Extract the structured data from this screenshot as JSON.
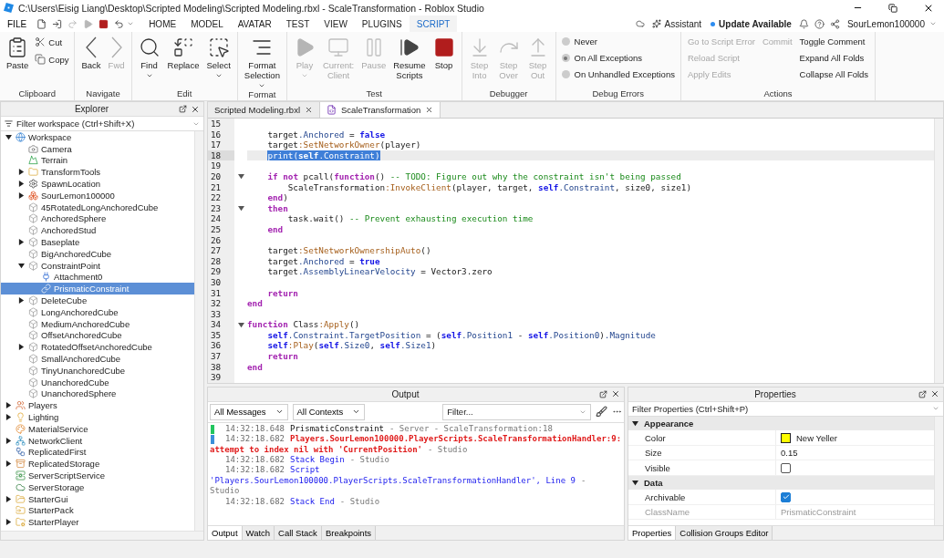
{
  "window": {
    "title": "C:\\Users\\Eisig Liang\\Desktop\\Scripted Modeling\\Scripted Modeling.rbxl - ScaleTransformation - Roblox Studio"
  },
  "menubar": {
    "file_menu": "FILE",
    "quick_actions": [
      {
        "disabled": false
      },
      {
        "disabled": false
      },
      {
        "disabled": true
      },
      {
        "disabled": true
      },
      {
        "disabled": false
      },
      {
        "disabled": false
      }
    ],
    "tabs": [
      {
        "label": "HOME",
        "selected": false
      },
      {
        "label": "MODEL",
        "selected": false
      },
      {
        "label": "AVATAR",
        "selected": false
      },
      {
        "label": "TEST",
        "selected": false
      },
      {
        "label": "VIEW",
        "selected": false
      },
      {
        "label": "PLUGINS",
        "selected": false
      },
      {
        "label": "SCRIPT",
        "selected": true
      }
    ],
    "assistant": "Assistant",
    "update": "Update Available",
    "user": "SourLemon100000"
  },
  "ribbon": {
    "groups": [
      {
        "label": "Clipboard",
        "columns": [
          [
            {
              "kind": "large",
              "label": "Paste",
              "disabled": false,
              "dropdown": false
            }
          ],
          [
            {
              "kind": "small",
              "label": "Cut",
              "disabled": false
            },
            {
              "kind": "small",
              "label": "Copy",
              "disabled": false
            }
          ]
        ]
      },
      {
        "label": "Navigate",
        "columns": [
          [
            {
              "kind": "large",
              "label": "Back",
              "disabled": false,
              "dropdown": false
            }
          ],
          [
            {
              "kind": "large",
              "label": "Fwd",
              "disabled": true,
              "dropdown": false
            }
          ]
        ]
      },
      {
        "label": "Edit",
        "columns": [
          [
            {
              "kind": "large",
              "label": "Find",
              "disabled": false,
              "dropdown": true
            }
          ],
          [
            {
              "kind": "large",
              "label": "Replace",
              "disabled": false,
              "dropdown": false
            }
          ],
          [
            {
              "kind": "large",
              "label": "Select",
              "disabled": false,
              "dropdown": true
            }
          ]
        ]
      },
      {
        "label": "Format",
        "columns": [
          [
            {
              "kind": "large",
              "label": "Format\nSelection",
              "disabled": false,
              "dropdown": true
            }
          ]
        ]
      },
      {
        "label": "Test",
        "columns": [
          [
            {
              "kind": "large",
              "label": "Play",
              "disabled": true,
              "dropdown": true
            }
          ],
          [
            {
              "kind": "large",
              "label": "Current:\nClient",
              "disabled": true,
              "dropdown": false
            }
          ],
          [
            {
              "kind": "large",
              "label": "Pause",
              "disabled": true,
              "dropdown": false
            }
          ],
          [
            {
              "kind": "large",
              "label": "Resume\nScripts",
              "disabled": false,
              "dropdown": false
            }
          ],
          [
            {
              "kind": "large",
              "label": "Stop",
              "disabled": false,
              "dropdown": false
            }
          ]
        ]
      },
      {
        "label": "Debugger",
        "columns": [
          [
            {
              "kind": "large",
              "label": "Step\nInto",
              "disabled": true,
              "dropdown": false
            }
          ],
          [
            {
              "kind": "large",
              "label": "Step\nOver",
              "disabled": true,
              "dropdown": false
            }
          ],
          [
            {
              "kind": "large",
              "label": "Step\nOut",
              "disabled": true,
              "dropdown": false
            }
          ]
        ]
      },
      {
        "label": "Debug Errors",
        "columns": [
          [
            {
              "kind": "radio",
              "label": "Never",
              "selected": false
            },
            {
              "kind": "radio",
              "label": "On All Exceptions",
              "selected": true
            },
            {
              "kind": "radio",
              "label": "On Unhandled Exceptions",
              "selected": false
            }
          ]
        ]
      },
      {
        "label": "Actions",
        "columns": [
          [
            {
              "kind": "link",
              "label": "Go to Script Error",
              "disabled": true
            },
            {
              "kind": "link",
              "label": "Reload Script",
              "disabled": true
            },
            {
              "kind": "link",
              "label": "Apply Edits",
              "disabled": true
            }
          ],
          [
            {
              "kind": "link",
              "label": "Commit",
              "disabled": true
            }
          ],
          [
            {
              "kind": "link",
              "label": "Toggle Comment",
              "disabled": false
            },
            {
              "kind": "link",
              "label": "Expand All Folds",
              "disabled": false
            },
            {
              "kind": "link",
              "label": "Collapse All Folds",
              "disabled": false
            }
          ]
        ]
      }
    ]
  },
  "explorer": {
    "title": "Explorer",
    "filter": {
      "placeholder": "Filter workspace (Ctrl+Shift+X)"
    },
    "tree": [
      {
        "label": "Workspace",
        "kind": "workspace",
        "selected": false,
        "expanded": true,
        "children": [
          {
            "label": "Camera",
            "kind": "camera",
            "selected": false
          },
          {
            "label": "Terrain",
            "kind": "terrain",
            "selected": false
          },
          {
            "label": "TransformTools",
            "kind": "folder",
            "selected": false,
            "expanded": false
          },
          {
            "label": "SpawnLocation",
            "kind": "spawn",
            "selected": false,
            "expanded": false
          },
          {
            "label": "SourLemon100000",
            "kind": "model",
            "selected": false,
            "expanded": false
          },
          {
            "label": "45RotatedLongAnchoredCube",
            "kind": "part",
            "selected": false
          },
          {
            "label": "AnchoredSphere",
            "kind": "part",
            "selected": false
          },
          {
            "label": "AnchoredStud",
            "kind": "part",
            "selected": false
          },
          {
            "label": "Baseplate",
            "kind": "part",
            "selected": false,
            "expanded": false
          },
          {
            "label": "BigAnchoredCube",
            "kind": "part",
            "selected": false
          },
          {
            "label": "ConstraintPoint",
            "kind": "part",
            "selected": false,
            "expanded": true,
            "children": [
              {
                "label": "Attachment0",
                "kind": "attachment",
                "selected": false
              },
              {
                "label": "PrismaticConstraint",
                "kind": "constraint",
                "selected": true
              }
            ]
          },
          {
            "label": "DeleteCube",
            "kind": "part",
            "selected": false,
            "expanded": false
          },
          {
            "label": "LongAnchoredCube",
            "kind": "part",
            "selected": false
          },
          {
            "label": "MediumAnchoredCube",
            "kind": "part",
            "selected": false
          },
          {
            "label": "OffsetAnchoredCube",
            "kind": "part",
            "selected": false
          },
          {
            "label": "RotatedOffsetAnchoredCube",
            "kind": "part",
            "selected": false,
            "expanded": false
          },
          {
            "label": "SmallAnchoredCube",
            "kind": "part",
            "selected": false
          },
          {
            "label": "TinyUnanchoredCube",
            "kind": "part",
            "selected": false
          },
          {
            "label": "UnanchoredCube",
            "kind": "part",
            "selected": false
          },
          {
            "label": "UnanchoredSphere",
            "kind": "part",
            "selected": false
          }
        ]
      },
      {
        "label": "Players",
        "kind": "players",
        "selected": false,
        "expanded": false
      },
      {
        "label": "Lighting",
        "kind": "lighting",
        "selected": false,
        "expanded": false
      },
      {
        "label": "MaterialService",
        "kind": "material",
        "selected": false
      },
      {
        "label": "NetworkClient",
        "kind": "network",
        "selected": false,
        "expanded": false
      },
      {
        "label": "ReplicatedFirst",
        "kind": "replicated",
        "selected": false
      },
      {
        "label": "ReplicatedStorage",
        "kind": "storage",
        "selected": false,
        "expanded": false
      },
      {
        "label": "ServerScriptService",
        "kind": "scriptservice",
        "selected": false
      },
      {
        "label": "ServerStorage",
        "kind": "serverstorage",
        "selected": false
      },
      {
        "label": "StarterGui",
        "kind": "gui",
        "selected": false,
        "expanded": false
      },
      {
        "label": "StarterPack",
        "kind": "pack",
        "selected": false
      },
      {
        "label": "StarterPlayer",
        "kind": "playerfolder",
        "selected": false,
        "expanded": false
      }
    ]
  },
  "editor": {
    "tabs": [
      {
        "label": "Scripted Modeling.rbxl",
        "selected": false
      },
      {
        "label": "ScaleTransformation",
        "selected": true
      }
    ],
    "lines": [
      {
        "number": "15",
        "fold": false,
        "selected": false
      },
      {
        "number": "16",
        "fold": false,
        "selected": false,
        "tokens": [
          {
            "kind": "plain",
            "text": "    target"
          },
          {
            "kind": "property",
            "text": ".Anchored"
          },
          {
            "kind": "plain",
            "text": " = "
          },
          {
            "kind": "literal",
            "text": "false"
          }
        ]
      },
      {
        "number": "17",
        "fold": false,
        "selected": false,
        "tokens": [
          {
            "kind": "plain",
            "text": "    target"
          },
          {
            "kind": "method",
            "text": ":SetNetworkOwner"
          },
          {
            "kind": "plain",
            "text": "(player)"
          }
        ]
      },
      {
        "number": "18",
        "fold": false,
        "selected": true,
        "tokens": [
          {
            "kind": "plain",
            "text": "    print("
          },
          {
            "kind": "literal",
            "text": "self"
          },
          {
            "kind": "property",
            "text": ".Constraint"
          },
          {
            "kind": "plain",
            "text": ")"
          }
        ]
      },
      {
        "number": "19",
        "fold": false,
        "selected": false
      },
      {
        "number": "20",
        "fold": true,
        "selected": false,
        "tokens": [
          {
            "kind": "keyword",
            "text": "    if"
          },
          {
            "kind": "keyword",
            "text": " not"
          },
          {
            "kind": "plain",
            "text": " pcall("
          },
          {
            "kind": "keyword",
            "text": "function"
          },
          {
            "kind": "plain",
            "text": "() "
          },
          {
            "kind": "comment",
            "text": "-- TODO: Figure out why the constraint isn't being passed"
          }
        ]
      },
      {
        "number": "21",
        "fold": false,
        "selected": false,
        "tokens": [
          {
            "kind": "plain",
            "text": "        ScaleTransformation"
          },
          {
            "kind": "method",
            "text": ":InvokeClient"
          },
          {
            "kind": "plain",
            "text": "(player, target, "
          },
          {
            "kind": "literal",
            "text": "self"
          },
          {
            "kind": "property",
            "text": ".Constraint"
          },
          {
            "kind": "plain",
            "text": ", size0, size1)"
          }
        ]
      },
      {
        "number": "22",
        "fold": false,
        "selected": false,
        "tokens": [
          {
            "kind": "keyword",
            "text": "    end"
          },
          {
            "kind": "plain",
            "text": ")"
          }
        ]
      },
      {
        "number": "23",
        "fold": true,
        "selected": false,
        "tokens": [
          {
            "kind": "keyword",
            "text": "    then"
          }
        ]
      },
      {
        "number": "24",
        "fold": false,
        "selected": false,
        "tokens": [
          {
            "kind": "plain",
            "text": "        task.wait() "
          },
          {
            "kind": "comment",
            "text": "-- Prevent exhausting execution time"
          }
        ]
      },
      {
        "number": "25",
        "fold": false,
        "selected": false,
        "tokens": [
          {
            "kind": "keyword",
            "text": "    end"
          }
        ]
      },
      {
        "number": "26",
        "fold": false,
        "selected": false
      },
      {
        "number": "27",
        "fold": false,
        "selected": false,
        "tokens": [
          {
            "kind": "plain",
            "text": "    target"
          },
          {
            "kind": "method",
            "text": ":SetNetworkOwnershipAuto"
          },
          {
            "kind": "plain",
            "text": "()"
          }
        ]
      },
      {
        "number": "28",
        "fold": false,
        "selected": false,
        "tokens": [
          {
            "kind": "plain",
            "text": "    target"
          },
          {
            "kind": "property",
            "text": ".Anchored"
          },
          {
            "kind": "plain",
            "text": " = "
          },
          {
            "kind": "literal",
            "text": "true"
          }
        ]
      },
      {
        "number": "29",
        "fold": false,
        "selected": false,
        "tokens": [
          {
            "kind": "plain",
            "text": "    target"
          },
          {
            "kind": "property",
            "text": ".AssemblyLinearVelocity"
          },
          {
            "kind": "plain",
            "text": " = Vector3.zero"
          }
        ]
      },
      {
        "number": "30",
        "fold": false,
        "selected": false
      },
      {
        "number": "31",
        "fold": false,
        "selected": false,
        "tokens": [
          {
            "kind": "keyword",
            "text": "    return"
          }
        ]
      },
      {
        "number": "32",
        "fold": false,
        "selected": false,
        "tokens": [
          {
            "kind": "keyword",
            "text": "end"
          }
        ]
      },
      {
        "number": "33",
        "fold": false,
        "selected": false
      },
      {
        "number": "34",
        "fold": true,
        "selected": false,
        "tokens": [
          {
            "kind": "keyword",
            "text": "function"
          },
          {
            "kind": "plain",
            "text": " Class"
          },
          {
            "kind": "method",
            "text": ":Apply"
          },
          {
            "kind": "plain",
            "text": "()"
          }
        ]
      },
      {
        "number": "35",
        "fold": false,
        "selected": false,
        "tokens": [
          {
            "kind": "literal",
            "text": "    self"
          },
          {
            "kind": "property",
            "text": ".Constraint.TargetPosition"
          },
          {
            "kind": "plain",
            "text": " = ("
          },
          {
            "kind": "literal",
            "text": "self"
          },
          {
            "kind": "property",
            "text": ".Position1"
          },
          {
            "kind": "plain",
            "text": " - "
          },
          {
            "kind": "literal",
            "text": "self"
          },
          {
            "kind": "property",
            "text": ".Position0"
          },
          {
            "kind": "plain",
            "text": ")"
          },
          {
            "kind": "property",
            "text": ".Magnitude"
          }
        ]
      },
      {
        "number": "36",
        "fold": false,
        "selected": false,
        "tokens": [
          {
            "kind": "literal",
            "text": "    self"
          },
          {
            "kind": "method",
            "text": ":Play"
          },
          {
            "kind": "plain",
            "text": "("
          },
          {
            "kind": "literal",
            "text": "self"
          },
          {
            "kind": "property",
            "text": ".Size0"
          },
          {
            "kind": "plain",
            "text": ", "
          },
          {
            "kind": "literal",
            "text": "self"
          },
          {
            "kind": "property",
            "text": ".Size1"
          },
          {
            "kind": "plain",
            "text": ")"
          }
        ]
      },
      {
        "number": "37",
        "fold": false,
        "selected": false,
        "tokens": [
          {
            "kind": "keyword",
            "text": "    return"
          }
        ]
      },
      {
        "number": "38",
        "fold": false,
        "selected": false,
        "tokens": [
          {
            "kind": "keyword",
            "text": "end"
          }
        ]
      },
      {
        "number": "39",
        "fold": false,
        "selected": false
      }
    ]
  },
  "output": {
    "title": "Output",
    "message_filter": "All Messages",
    "context_filter": "All Contexts",
    "filter": {
      "placeholder": "Filter..."
    },
    "entries": [
      {
        "color": "#22c55e",
        "parts": [
          {
            "kind": "time",
            "text": "14:32:18.648"
          },
          {
            "kind": "message",
            "text": "PrismaticConstraint"
          },
          {
            "kind": "source",
            "text": "-  Server - ScaleTransformation:18"
          }
        ]
      },
      {
        "color": "#3b8fd9",
        "parts": [
          {
            "kind": "time",
            "text": "14:32:18.682"
          },
          {
            "kind": "error",
            "text": "Players.SourLemon100000.PlayerScripts.ScaleTransformationHandler:9: attempt to index nil with 'CurrentPosition'"
          },
          {
            "kind": "source",
            "text": "-  Studio"
          }
        ]
      },
      {
        "parts": [
          {
            "kind": "time",
            "text": "14:32:18.682"
          },
          {
            "kind": "stack",
            "text": "Stack Begin"
          },
          {
            "kind": "source",
            "text": "-  Studio"
          }
        ]
      },
      {
        "parts": [
          {
            "kind": "time",
            "text": "14:32:18.682"
          },
          {
            "kind": "stack",
            "text": "Script 'Players.SourLemon100000.PlayerScripts.ScaleTransformationHandler', Line 9"
          },
          {
            "kind": "source",
            "text": "-  Studio"
          }
        ]
      },
      {
        "parts": [
          {
            "kind": "time",
            "text": "14:32:18.682"
          },
          {
            "kind": "stack",
            "text": "Stack End"
          },
          {
            "kind": "source",
            "text": "-  Studio"
          }
        ]
      }
    ],
    "tabs": [
      {
        "label": "Output",
        "selected": true
      },
      {
        "label": "Watch",
        "selected": false
      },
      {
        "label": "Call Stack",
        "selected": false
      },
      {
        "label": "Breakpoints",
        "selected": false
      }
    ]
  },
  "properties": {
    "title": "Properties",
    "filter": {
      "placeholder": "Filter Properties (Ctrl+Shift+P)"
    },
    "sections": [
      {
        "label": "Appearance",
        "expanded": true,
        "rows": [
          {
            "kind": "color",
            "name": "Color",
            "value": "New Yeller",
            "color": "#ffff00"
          },
          {
            "kind": "text",
            "name": "Size",
            "value": "0.15"
          },
          {
            "kind": "checkbox",
            "name": "Visible",
            "checked": false
          }
        ]
      },
      {
        "label": "Data",
        "expanded": true,
        "rows": [
          {
            "kind": "checkbox",
            "name": "Archivable",
            "checked": true
          },
          {
            "kind": "text",
            "name": "ClassName",
            "value": "PrismaticConstraint",
            "disabled": true
          }
        ]
      }
    ],
    "tabs": [
      {
        "label": "Properties",
        "selected": true
      },
      {
        "label": "Collision Groups Editor",
        "selected": false
      }
    ]
  }
}
